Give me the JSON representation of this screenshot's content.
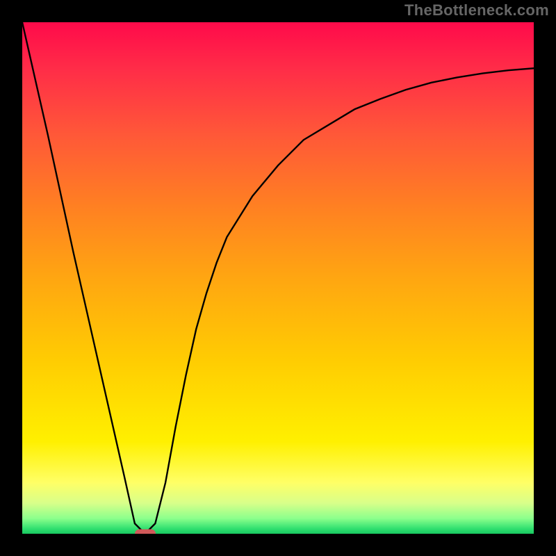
{
  "watermark": "TheBottleneck.com",
  "chart_data": {
    "type": "line",
    "title": "",
    "xlabel": "",
    "ylabel": "",
    "xlim": [
      0,
      100
    ],
    "ylim": [
      0,
      100
    ],
    "grid": false,
    "background_gradient": {
      "orientation": "vertical",
      "stops": [
        {
          "pos": 0.0,
          "color": "#ff0a4a"
        },
        {
          "pos": 0.09,
          "color": "#ff2c48"
        },
        {
          "pos": 0.22,
          "color": "#ff5838"
        },
        {
          "pos": 0.36,
          "color": "#ff8022"
        },
        {
          "pos": 0.5,
          "color": "#ffa611"
        },
        {
          "pos": 0.66,
          "color": "#ffcc02"
        },
        {
          "pos": 0.82,
          "color": "#fff000"
        },
        {
          "pos": 0.9,
          "color": "#ffff66"
        },
        {
          "pos": 0.94,
          "color": "#d8ff8a"
        },
        {
          "pos": 0.97,
          "color": "#8cff8c"
        },
        {
          "pos": 0.99,
          "color": "#30e070"
        },
        {
          "pos": 1.0,
          "color": "#18c760"
        }
      ]
    },
    "series": [
      {
        "name": "curve",
        "color": "#000000",
        "x": [
          0,
          5,
          10,
          15,
          20,
          22,
          24,
          26,
          28,
          30,
          32,
          34,
          36,
          38,
          40,
          45,
          50,
          55,
          60,
          65,
          70,
          75,
          80,
          85,
          90,
          95,
          100
        ],
        "y": [
          100,
          78,
          55,
          33,
          11,
          2,
          0,
          2,
          10,
          21,
          31,
          40,
          47,
          53,
          58,
          66,
          72,
          77,
          80,
          83,
          85,
          86.8,
          88.2,
          89.2,
          90,
          90.6,
          91
        ]
      }
    ],
    "marker": {
      "x": 24,
      "y": 0,
      "color": "#d05a5a",
      "shape": "pill"
    }
  }
}
